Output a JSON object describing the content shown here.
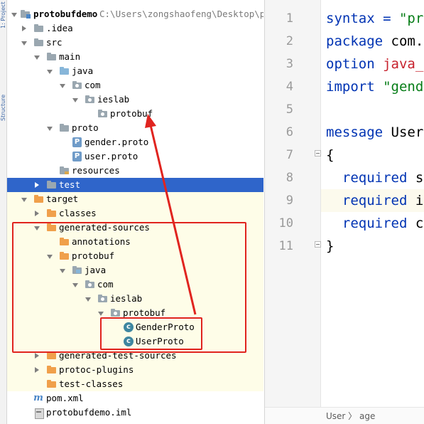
{
  "toolstrip": {
    "labels": [
      "1: Project",
      "Structure"
    ]
  },
  "project_tree": {
    "rows": [
      {
        "label": "protobufdemo",
        "path": "C:\\Users\\zongshaofeng\\Desktop\\pro"
      },
      {
        "label": ".idea"
      },
      {
        "label": "src"
      },
      {
        "label": "main"
      },
      {
        "label": "java"
      },
      {
        "label": "com"
      },
      {
        "label": "ieslab"
      },
      {
        "label": "protobuf"
      },
      {
        "label": "proto"
      },
      {
        "label": "gender.proto"
      },
      {
        "label": "user.proto"
      },
      {
        "label": "resources"
      },
      {
        "label": "test"
      },
      {
        "label": "target"
      },
      {
        "label": "classes"
      },
      {
        "label": "generated-sources"
      },
      {
        "label": "annotations"
      },
      {
        "label": "protobuf"
      },
      {
        "label": "java"
      },
      {
        "label": "com"
      },
      {
        "label": "ieslab"
      },
      {
        "label": "protobuf"
      },
      {
        "label": "GenderProto"
      },
      {
        "label": "UserProto"
      },
      {
        "label": "generated-test-sources"
      },
      {
        "label": "protoc-plugins"
      },
      {
        "label": "test-classes"
      },
      {
        "label": "pom.xml"
      },
      {
        "label": "protobufdemo.iml"
      }
    ]
  },
  "annotations": {
    "box_color": "#e0241f",
    "arrow_color": "#e0241f"
  },
  "editor": {
    "line_numbers": [
      "1",
      "2",
      "3",
      "4",
      "5",
      "6",
      "7",
      "8",
      "9",
      "10",
      "11"
    ],
    "lines": [
      {
        "a": "syntax = ",
        "b": "\"pr"
      },
      {
        "a": "package ",
        "b": "com."
      },
      {
        "a": "option ",
        "b": "java_"
      },
      {
        "a": "import ",
        "b": "\"gend"
      },
      {
        "a": "",
        "b": ""
      },
      {
        "a": "message ",
        "b": "User"
      },
      {
        "a": "{",
        "b": ""
      },
      {
        "a": "  required ",
        "b": "s"
      },
      {
        "a": "  required ",
        "b": "i"
      },
      {
        "a": "  required ",
        "b": "c"
      },
      {
        "a": "}",
        "b": ""
      }
    ],
    "breadcrumb": "User 〉 age"
  }
}
